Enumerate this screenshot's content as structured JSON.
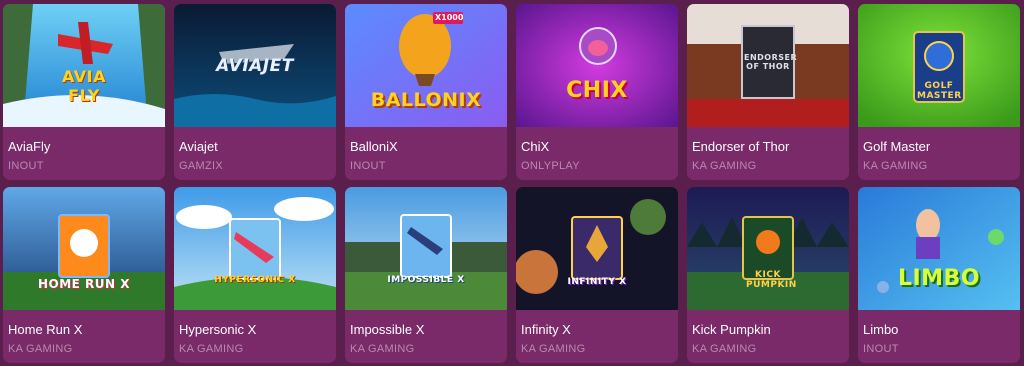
{
  "games": [
    {
      "title": "AviaFly",
      "provider": "INOUT",
      "logo": "AVIA FLY"
    },
    {
      "title": "Aviajet",
      "provider": "GAMZIX",
      "logo": "AVIAJET"
    },
    {
      "title": "BalloniX",
      "provider": "INOUT",
      "logo": "BALLONIX",
      "badge": "X1000"
    },
    {
      "title": "ChiX",
      "provider": "ONLYPLAY",
      "logo": "CHIX"
    },
    {
      "title": "Endorser of Thor",
      "provider": "KA GAMING",
      "logo": "ENDORSER OF THOR"
    },
    {
      "title": "Golf Master",
      "provider": "KA GAMING",
      "logo": "GOLF MASTER"
    },
    {
      "title": "Home Run X",
      "provider": "KA GAMING",
      "logo": "HOME RUN X"
    },
    {
      "title": "Hypersonic X",
      "provider": "KA GAMING",
      "logo": "HYPERSONIC X"
    },
    {
      "title": "Impossible X",
      "provider": "KA GAMING",
      "logo": "IMPOSSIBLE X"
    },
    {
      "title": "Infinity X",
      "provider": "KA GAMING",
      "logo": "INFINITY X"
    },
    {
      "title": "Kick Pumpkin",
      "provider": "KA GAMING",
      "logo": "KICK PUMPKIN"
    },
    {
      "title": "Limbo",
      "provider": "INOUT",
      "logo": "LIMBO"
    }
  ],
  "colors": {
    "page_bg": "#5a1f4d",
    "card_bg": "#7a2a68",
    "title": "#ffffff",
    "provider": "#b98aae"
  }
}
